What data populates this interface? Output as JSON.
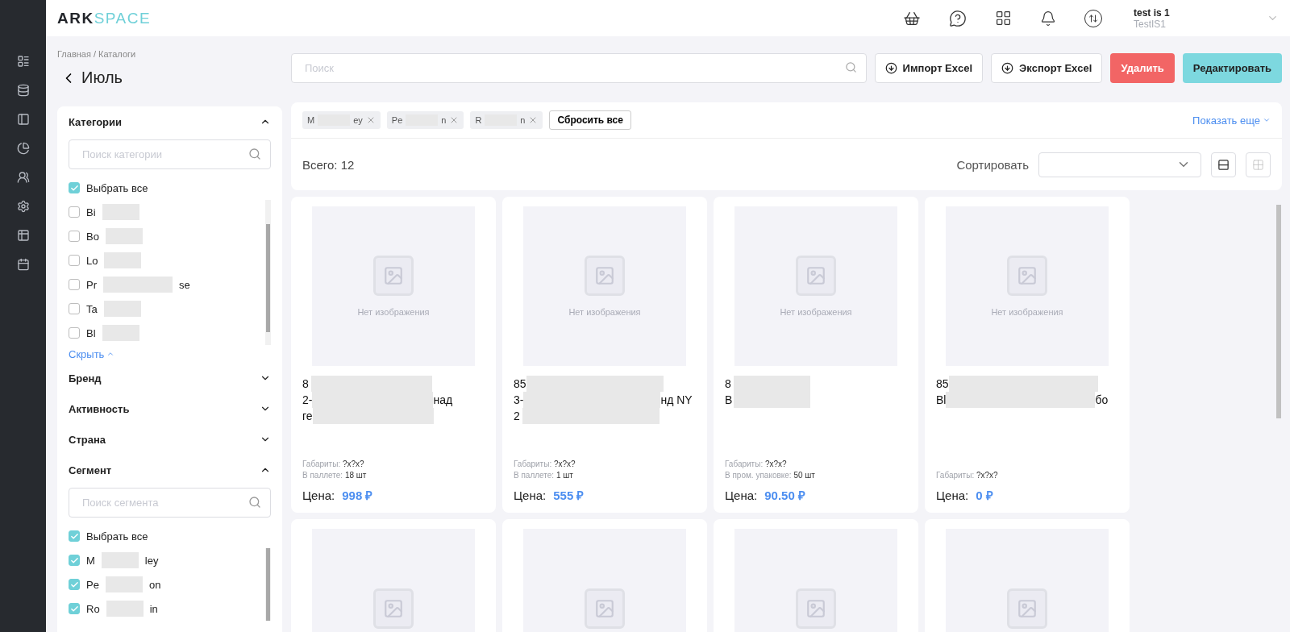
{
  "logo": {
    "primary": "ARK",
    "accent": "SPACE"
  },
  "user": {
    "name": "test is 1",
    "login": "TestIS1"
  },
  "breadcrumb": "Главная / Каталоги",
  "title": "Июль",
  "search": {
    "placeholder": "Поиск"
  },
  "actions": [
    {
      "label": "Импорт Excel",
      "kind": "outline"
    },
    {
      "label": "Экспорт Excel",
      "kind": "outline"
    },
    {
      "label": "Удалить",
      "kind": "danger"
    },
    {
      "label": "Редактировать",
      "kind": "primary"
    }
  ],
  "filters": [
    {
      "title": "Категории",
      "expanded": true,
      "search_placeholder": "Поиск категории",
      "select_all": {
        "label": "Выбрать все",
        "checked": true
      },
      "items": [
        {
          "before": "Bi",
          "checked": false
        },
        {
          "before": "Bo",
          "checked": false
        },
        {
          "before": "Lo",
          "checked": false
        },
        {
          "before": "Pr",
          "after": "se",
          "checked": false
        },
        {
          "before": "Ta",
          "checked": false
        },
        {
          "before": "Bl",
          "checked": false
        }
      ],
      "collapse_link": "Скрыть"
    },
    {
      "title": "Бренд",
      "expanded": false
    },
    {
      "title": "Активность",
      "expanded": false
    },
    {
      "title": "Страна",
      "expanded": false
    },
    {
      "title": "Сегмент",
      "expanded": true,
      "search_placeholder": "Поиск сегмента",
      "select_all": {
        "label": "Выбрать все",
        "checked": true
      },
      "items": [
        {
          "before": "M",
          "after": "ley",
          "checked": true
        },
        {
          "before": "Pe",
          "after": "on",
          "checked": true
        },
        {
          "before": "Ro",
          "after": "in",
          "checked": true
        }
      ]
    }
  ],
  "chips": [
    {
      "before": "M",
      "after": "ey"
    },
    {
      "before": "Pe",
      "after": "n"
    },
    {
      "before": "R",
      "after": "n"
    }
  ],
  "reset": "Сбросить все",
  "show_more": "Показать еще",
  "total": "Всего: 12",
  "sort": {
    "label": "Сортировать"
  },
  "view": [
    {
      "kind": "list",
      "selected": true
    },
    {
      "kind": "grid",
      "selected": false
    }
  ],
  "cards": [
    {
      "kind": "full",
      "no_image": "Нет изображения",
      "title_lines": [
        {
          "before": "8"
        },
        {
          "before": "2-",
          "after": "над"
        },
        {
          "before": "ге"
        }
      ],
      "specs": [
        {
          "label": "Габариты:",
          "value": "?x?x?"
        },
        {
          "label": "В паллете:",
          "value": "18 шт"
        }
      ],
      "price_label": "Цена:",
      "price": "998 ₽"
    },
    {
      "kind": "full",
      "no_image": "Нет изображения",
      "title_lines": [
        {
          "before": "85"
        },
        {
          "before": "3-",
          "after": "нд NY"
        },
        {
          "before": "2"
        }
      ],
      "specs": [
        {
          "label": "Габариты:",
          "value": "?x?x?"
        },
        {
          "label": "В паллете:",
          "value": "1 шт"
        }
      ],
      "price_label": "Цена:",
      "price": "555 ₽"
    },
    {
      "kind": "full",
      "no_image": "Нет изображения",
      "title_lines": [
        {
          "before": "8"
        },
        {
          "before": "B"
        }
      ],
      "specs": [
        {
          "label": "Габариты:",
          "value": "?x?x?"
        },
        {
          "label": "В пром. упаковке:",
          "value": "50 шт"
        }
      ],
      "price_label": "Цена:",
      "price": "90.50 ₽"
    },
    {
      "kind": "full",
      "no_image": "Нет изображения",
      "title_lines": [
        {
          "before": "85"
        },
        {
          "before": "Bl",
          "after": "бо"
        }
      ],
      "specs": [
        {
          "label": "Габариты:",
          "value": "?x?x?"
        }
      ],
      "price_label": "Цена:",
      "price": "0 ₽"
    },
    {
      "kind": "cut"
    },
    {
      "kind": "cut"
    },
    {
      "kind": "cut"
    },
    {
      "kind": "cut"
    }
  ]
}
